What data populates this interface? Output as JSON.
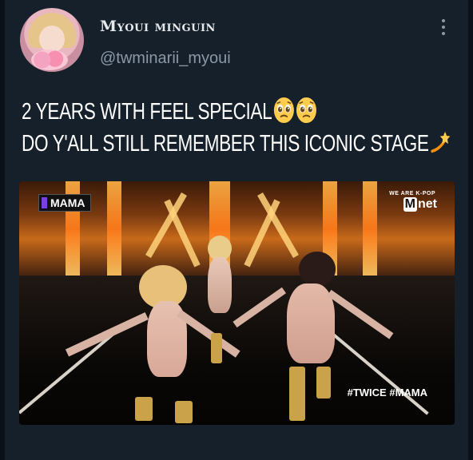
{
  "tweet": {
    "display_name": "Myoui minguin",
    "handle": "@twminarii_myoui",
    "text_line1": "2 YEARS WITH FEEL SPECIAL",
    "text_line2": "DO Y'ALL STILL REMEMBER THIS ICONIC STAGE",
    "emojis_line1": [
      "pleading-face",
      "pleading-face"
    ],
    "emoji_line2": "dizzy"
  },
  "media": {
    "logo_left": "MAMA",
    "logo_right_tagline": "WE ARE K-POP",
    "logo_right": "net",
    "logo_right_badge": "M",
    "hashtags": "#TWICE #MAMA"
  },
  "colors": {
    "background": "#15202b",
    "text": "#ffffff",
    "secondary_text": "#8b98a5",
    "stage_orange": "#ff7a1a"
  }
}
